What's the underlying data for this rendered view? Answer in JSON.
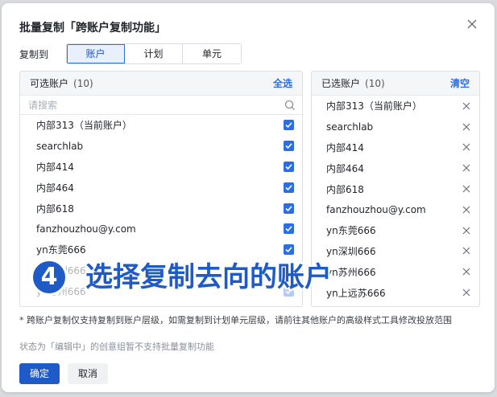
{
  "dialog": {
    "title": "批量复制「跨账户复制功能」",
    "copy_to_label": "复制到",
    "segments": [
      {
        "label": "账户",
        "active": true
      },
      {
        "label": "计划",
        "active": false
      },
      {
        "label": "单元",
        "active": false
      }
    ]
  },
  "available": {
    "title": "可选账户",
    "count": "(10)",
    "action": "全选",
    "search_placeholder": "请搜索",
    "items": [
      "内部313（当前账户）",
      "searchlab",
      "内部414",
      "内部464",
      "内部618",
      "fanzhouzhou@y.com",
      "yn东莞666",
      "yn深圳666",
      "yn苏州666"
    ]
  },
  "selected": {
    "title": "已选账户",
    "count": "(10)",
    "action": "清空",
    "items": [
      "内部313（当前账户）",
      "searchlab",
      "内部414",
      "内部464",
      "内部618",
      "fanzhouzhou@y.com",
      "yn东莞666",
      "yn深圳666",
      "yn苏州666",
      "yn上远苏666"
    ]
  },
  "footnote": "* 跨账户复制仅支持复制到账户层级，如需复制到计划单元层级，请前往其他账户的高级样式工具修改投放范围",
  "status_note": "状态为「编辑中」的创意组暂不支持批量复制功能",
  "buttons": {
    "ok": "确定",
    "cancel": "取消"
  },
  "overlay": {
    "step": "4",
    "caption": "选择复制去向的账户"
  },
  "colors": {
    "accent": "#2b6de5",
    "primary_button": "#1f5bc7"
  }
}
